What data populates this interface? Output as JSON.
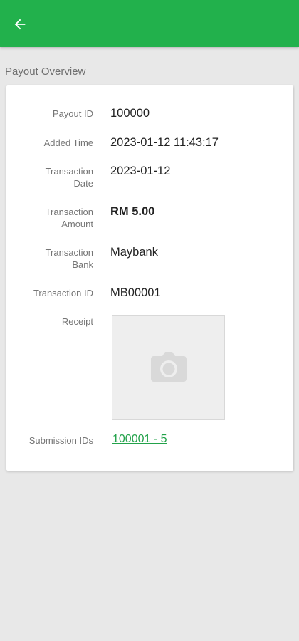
{
  "colors": {
    "appbar": "#22b14c",
    "link": "#22a24a",
    "background": "#e8e8e8"
  },
  "appbar": {
    "back_icon": "arrow-left-icon"
  },
  "section_title": "Payout Overview",
  "details": {
    "payout_id": {
      "label": "Payout ID",
      "value": "100000"
    },
    "added_time": {
      "label": "Added Time",
      "value": "2023-01-12 11:43:17"
    },
    "transaction_date": {
      "label_line1": "Transaction",
      "label_line2": "Date",
      "value": "2023-01-12"
    },
    "transaction_amount": {
      "label_line1": "Transaction",
      "label_line2": "Amount",
      "value": "RM 5.00"
    },
    "transaction_bank": {
      "label_line1": "Transaction",
      "label_line2": "Bank",
      "value": "Maybank"
    },
    "transaction_id": {
      "label": "Transaction ID",
      "value": "MB00001"
    },
    "receipt": {
      "label": "Receipt",
      "placeholder_icon": "camera-icon"
    },
    "submission_ids": {
      "label": "Submission IDs",
      "value": "100001 - 5"
    }
  }
}
